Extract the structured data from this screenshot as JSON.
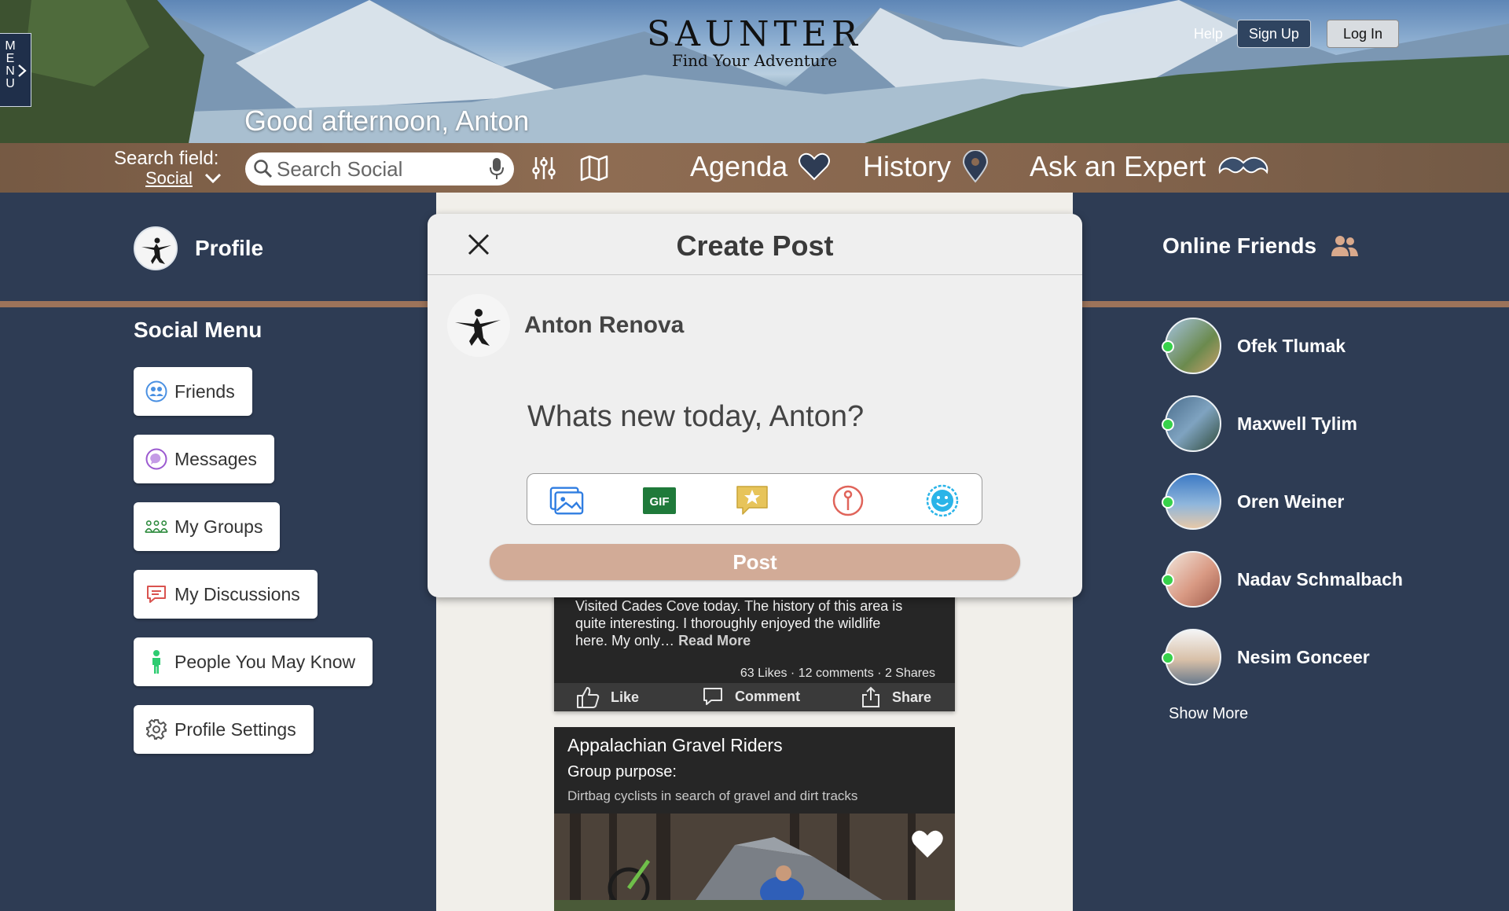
{
  "app": {
    "brand": "SAUNTER",
    "tagline": "Find Your Adventure",
    "menu_letters": [
      "M",
      "E",
      "N",
      "U"
    ],
    "greeting": "Good afternoon, Anton"
  },
  "top_links": {
    "help": "Help",
    "sign_up": "Sign Up",
    "log_in": "Log In"
  },
  "search": {
    "field_label": "Search field:",
    "field_value": "Social",
    "placeholder": "Search Social"
  },
  "nav": [
    {
      "label": "Agenda",
      "icon": "heart-icon"
    },
    {
      "label": "History",
      "icon": "map-pin-icon"
    },
    {
      "label": "Ask an Expert",
      "icon": "mustache-icon"
    }
  ],
  "left": {
    "profile_label": "Profile",
    "social_menu_title": "Social Menu",
    "menu_items": [
      {
        "label": "Friends",
        "icon": "friends-icon",
        "color": "#4a90e2"
      },
      {
        "label": "Messages",
        "icon": "messages-icon",
        "color": "#9b59d0"
      },
      {
        "label": "My Groups",
        "icon": "groups-icon",
        "color": "#2e8b3e"
      },
      {
        "label": "My Discussions",
        "icon": "discussions-icon",
        "color": "#d9534f"
      },
      {
        "label": "People You May Know",
        "icon": "person-icon",
        "color": "#2ecc71"
      },
      {
        "label": "Profile Settings",
        "icon": "gear-icon",
        "color": "#555555"
      }
    ]
  },
  "right": {
    "title": "Online Friends",
    "friends": [
      {
        "name": "Ofek Tlumak"
      },
      {
        "name": "Maxwell Tylim"
      },
      {
        "name": "Oren Weiner"
      },
      {
        "name": "Nadav Schmalbach"
      },
      {
        "name": "Nesim Gonceer"
      }
    ],
    "show_more": "Show More"
  },
  "feed": {
    "post": {
      "text": "Visited Cades Cove today. The history of this area is quite interesting. I thoroughly enjoyed the wildlife here. My only…",
      "read_more": "Read More",
      "stats": "63 Likes · 12 comments · 2 Shares",
      "actions": {
        "like": "Like",
        "comment": "Comment",
        "share": "Share"
      }
    },
    "group": {
      "title": "Appalachian Gravel Riders",
      "purpose_label": "Group purpose:",
      "description": "Dirtbag cyclists in search of gravel and dirt tracks"
    }
  },
  "modal": {
    "title": "Create Post",
    "user_name": "Anton Renova",
    "prompt_placeholder": "Whats new today, Anton?",
    "tools": [
      "photo-icon",
      "gif-icon",
      "star-review-icon",
      "location-pin-icon",
      "emoji-icon"
    ],
    "gif_label": "GIF",
    "post_button": "Post",
    "post_button_color": "#d2ab97"
  },
  "colors": {
    "page_bg": "#2e3c54",
    "divider": "#9c735a",
    "online_dot": "#37d14a",
    "feed_bg": "#f1efea"
  }
}
